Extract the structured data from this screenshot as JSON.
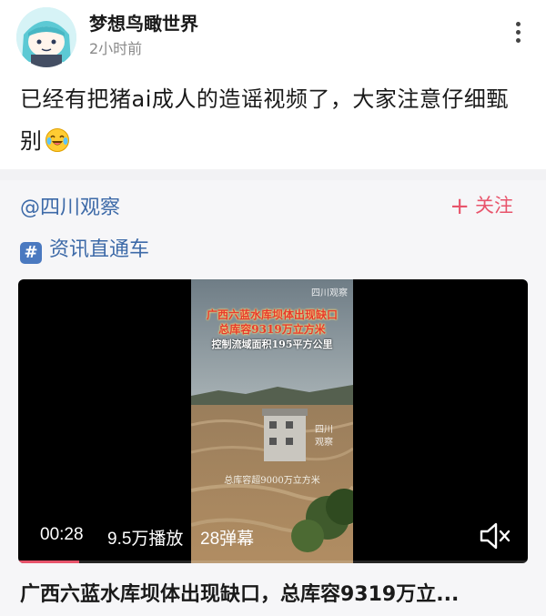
{
  "post": {
    "author_name": "梦想鸟瞰世界",
    "time": "2小时前",
    "text": "已经有把猪ai成人的造谣视频了，大家注意仔细甄别",
    "emoji_icon": "laughing-tears-emoji-icon"
  },
  "repost": {
    "source_handle": "@四川观察",
    "follow_plus": "+",
    "follow_label": "关注",
    "topic_icon_glyph": "#",
    "topic_label": "资讯直通车",
    "video": {
      "headline_line1": "广西六蓝水库坝体出现缺口",
      "headline_line2": "总库容9319万立方米",
      "headline_line3": "控制流域面积195平方公里",
      "watermark_top": "四川观察",
      "watermark_mid_1": "四川",
      "watermark_mid_2": "观察",
      "subtitle": "总库容超9000万立方米",
      "current_time": "00:28",
      "play_count": "9.5万播放",
      "danmaku_count": "28弹幕",
      "progress": 0.12
    },
    "title": "广西六蓝水库坝体出现缺口，总库容9319万立..."
  },
  "colors": {
    "link_blue": "#3d6aa8",
    "follow_pink": "#e8546b",
    "headline_red": "#e63a2e"
  }
}
